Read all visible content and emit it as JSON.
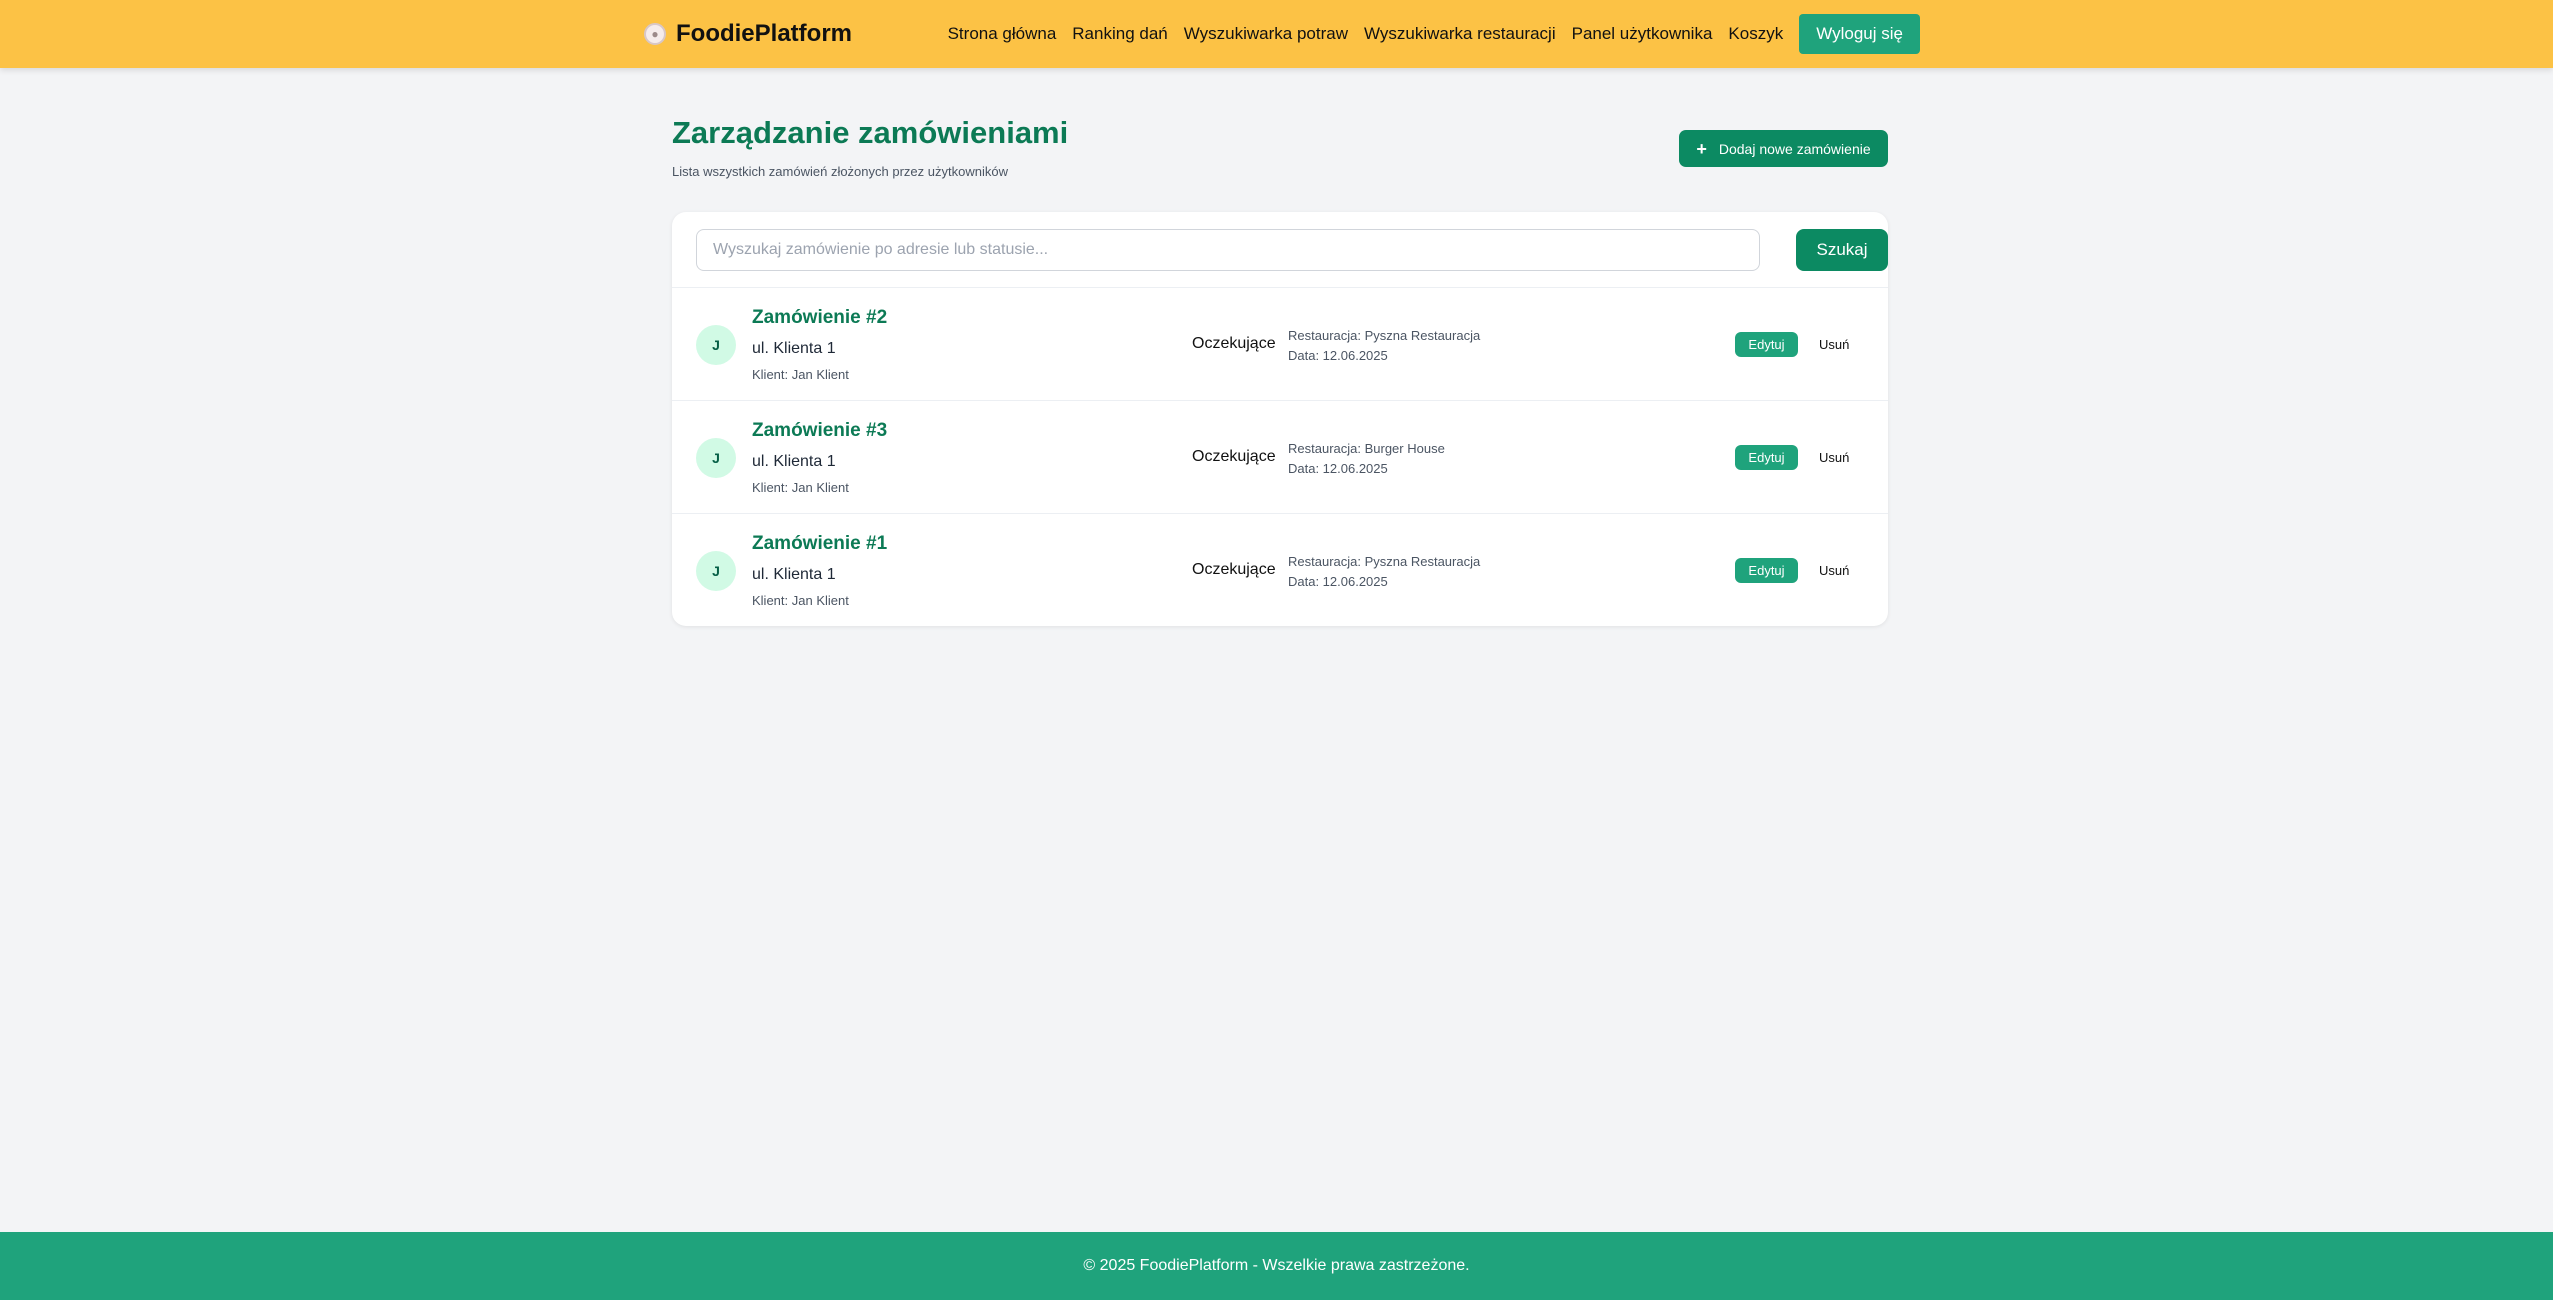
{
  "header": {
    "brand_icon": "plate-icon",
    "brand_name": "FoodiePlatform",
    "nav": [
      {
        "label": "Strona główna"
      },
      {
        "label": "Ranking dań"
      },
      {
        "label": "Wyszukiwarka potraw"
      },
      {
        "label": "Wyszukiwarka restauracji"
      },
      {
        "label": "Panel użytkownika"
      },
      {
        "label": "Koszyk"
      }
    ],
    "logout_label": "Wyloguj się"
  },
  "main": {
    "title": "Zarządzanie zamówieniami",
    "subtitle": "Lista wszystkich zamówień złożonych przez użytkowników",
    "add_button_icon": "plus-icon",
    "add_button_label": "Dodaj nowe zamówienie",
    "search": {
      "placeholder": "Wyszukaj zamówienie po adresie lub statusie...",
      "value": "",
      "button_label": "Szukaj"
    },
    "orders": [
      {
        "avatar": "J",
        "title": "Zamówienie #2",
        "address": "ul. Klienta 1",
        "client": "Klient: Jan Klient",
        "status": "Oczekujące",
        "restaurant": "Restauracja: Pyszna Restauracja",
        "date": "Data: 12.06.2025",
        "edit_label": "Edytuj",
        "delete_label": "Usuń"
      },
      {
        "avatar": "J",
        "title": "Zamówienie #3",
        "address": "ul. Klienta 1",
        "client": "Klient: Jan Klient",
        "status": "Oczekujące",
        "restaurant": "Restauracja: Burger House",
        "date": "Data: 12.06.2025",
        "edit_label": "Edytuj",
        "delete_label": "Usuń"
      },
      {
        "avatar": "J",
        "title": "Zamówienie #1",
        "address": "ul. Klienta 1",
        "client": "Klient: Jan Klient",
        "status": "Oczekujące",
        "restaurant": "Restauracja: Pyszna Restauracja",
        "date": "Data: 12.06.2025",
        "edit_label": "Edytuj",
        "delete_label": "Usuń"
      }
    ]
  },
  "footer": {
    "text": "© 2025 FoodiePlatform - Wszelkie prawa zastrzeżone."
  },
  "colors": {
    "header_bg": "#fcc245",
    "accent": "#0c8a62",
    "accent_light": "#1fa37c",
    "title_green": "#0c7a55",
    "page_bg": "#f3f4f6"
  }
}
